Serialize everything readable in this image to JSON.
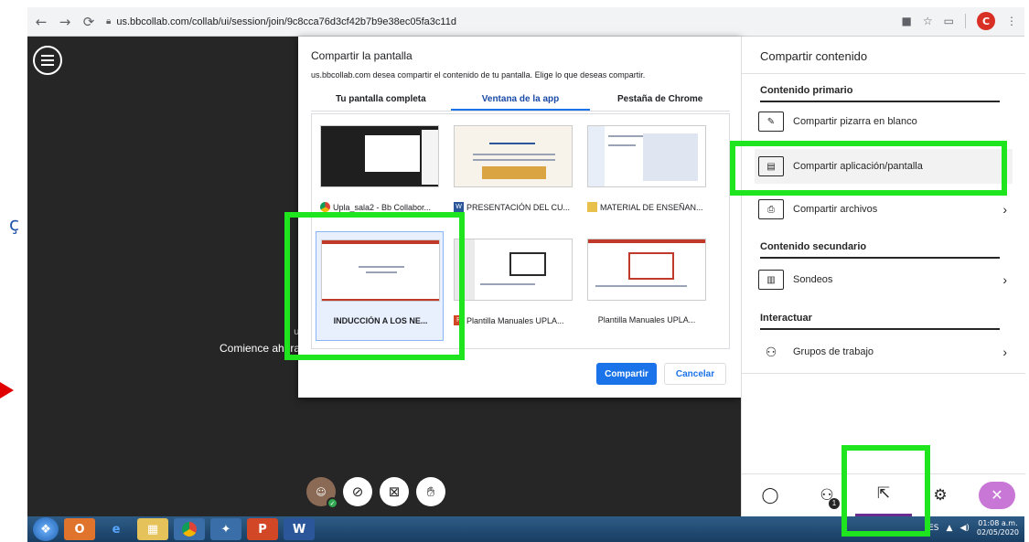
{
  "browser": {
    "url": "us.bbcollab.com/collab/ui/session/join/9c8cca76d3cf42b7b9e38ec05fa3c11d",
    "profile_initial": "C"
  },
  "stage": {
    "start_text": "Comience ahora",
    "partial_char": "u"
  },
  "dialog": {
    "title": "Compartir la pantalla",
    "subtitle": "us.bbcollab.com desea compartir el contenido de tu pantalla. Elige lo que deseas compartir.",
    "tabs": [
      "Tu pantalla completa",
      "Ventana de la app",
      "Pestaña de Chrome"
    ],
    "active_tab": 1,
    "windows": [
      {
        "label": "Upla_sala2 - Bb Collabor...",
        "icon": "chrome-icon"
      },
      {
        "label": "PRESENTACIÓN DEL CU...",
        "icon": "word-icon"
      },
      {
        "label": "MATERIAL DE ENSEÑAN...",
        "icon": "folder-icon"
      },
      {
        "label": "INDUCCIÓN A LOS NE...",
        "icon": "none",
        "selected": true
      },
      {
        "label": "Plantilla Manuales UPLA...",
        "icon": "powerpoint-icon"
      },
      {
        "label": "Plantilla Manuales UPLA...",
        "icon": "none"
      }
    ],
    "share_label": "Compartir",
    "cancel_label": "Cancelar"
  },
  "panel": {
    "title": "Compartir contenido",
    "primary_heading": "Contenido primario",
    "primary_items": [
      {
        "label": "Compartir pizarra en blanco",
        "chevron": false
      },
      {
        "label": "Compartir aplicación/pantalla",
        "chevron": false
      },
      {
        "label": "Compartir archivos",
        "chevron": true
      }
    ],
    "secondary_heading": "Contenido secundario",
    "secondary_items": [
      {
        "label": "Sondeos",
        "chevron": true
      }
    ],
    "interact_heading": "Interactuar",
    "interact_items": [
      {
        "label": "Grupos de trabajo",
        "chevron": true
      }
    ],
    "attendee_badge": "1"
  },
  "taskbar": {
    "lang": "ES",
    "time": "01:08 a.m.",
    "date": "02/05/2020"
  },
  "colors": {
    "highlight_box": "#1ee51e",
    "primary_button": "#1a73e8",
    "accent_purple": "#6b2c91",
    "stage_bg": "#262626"
  }
}
